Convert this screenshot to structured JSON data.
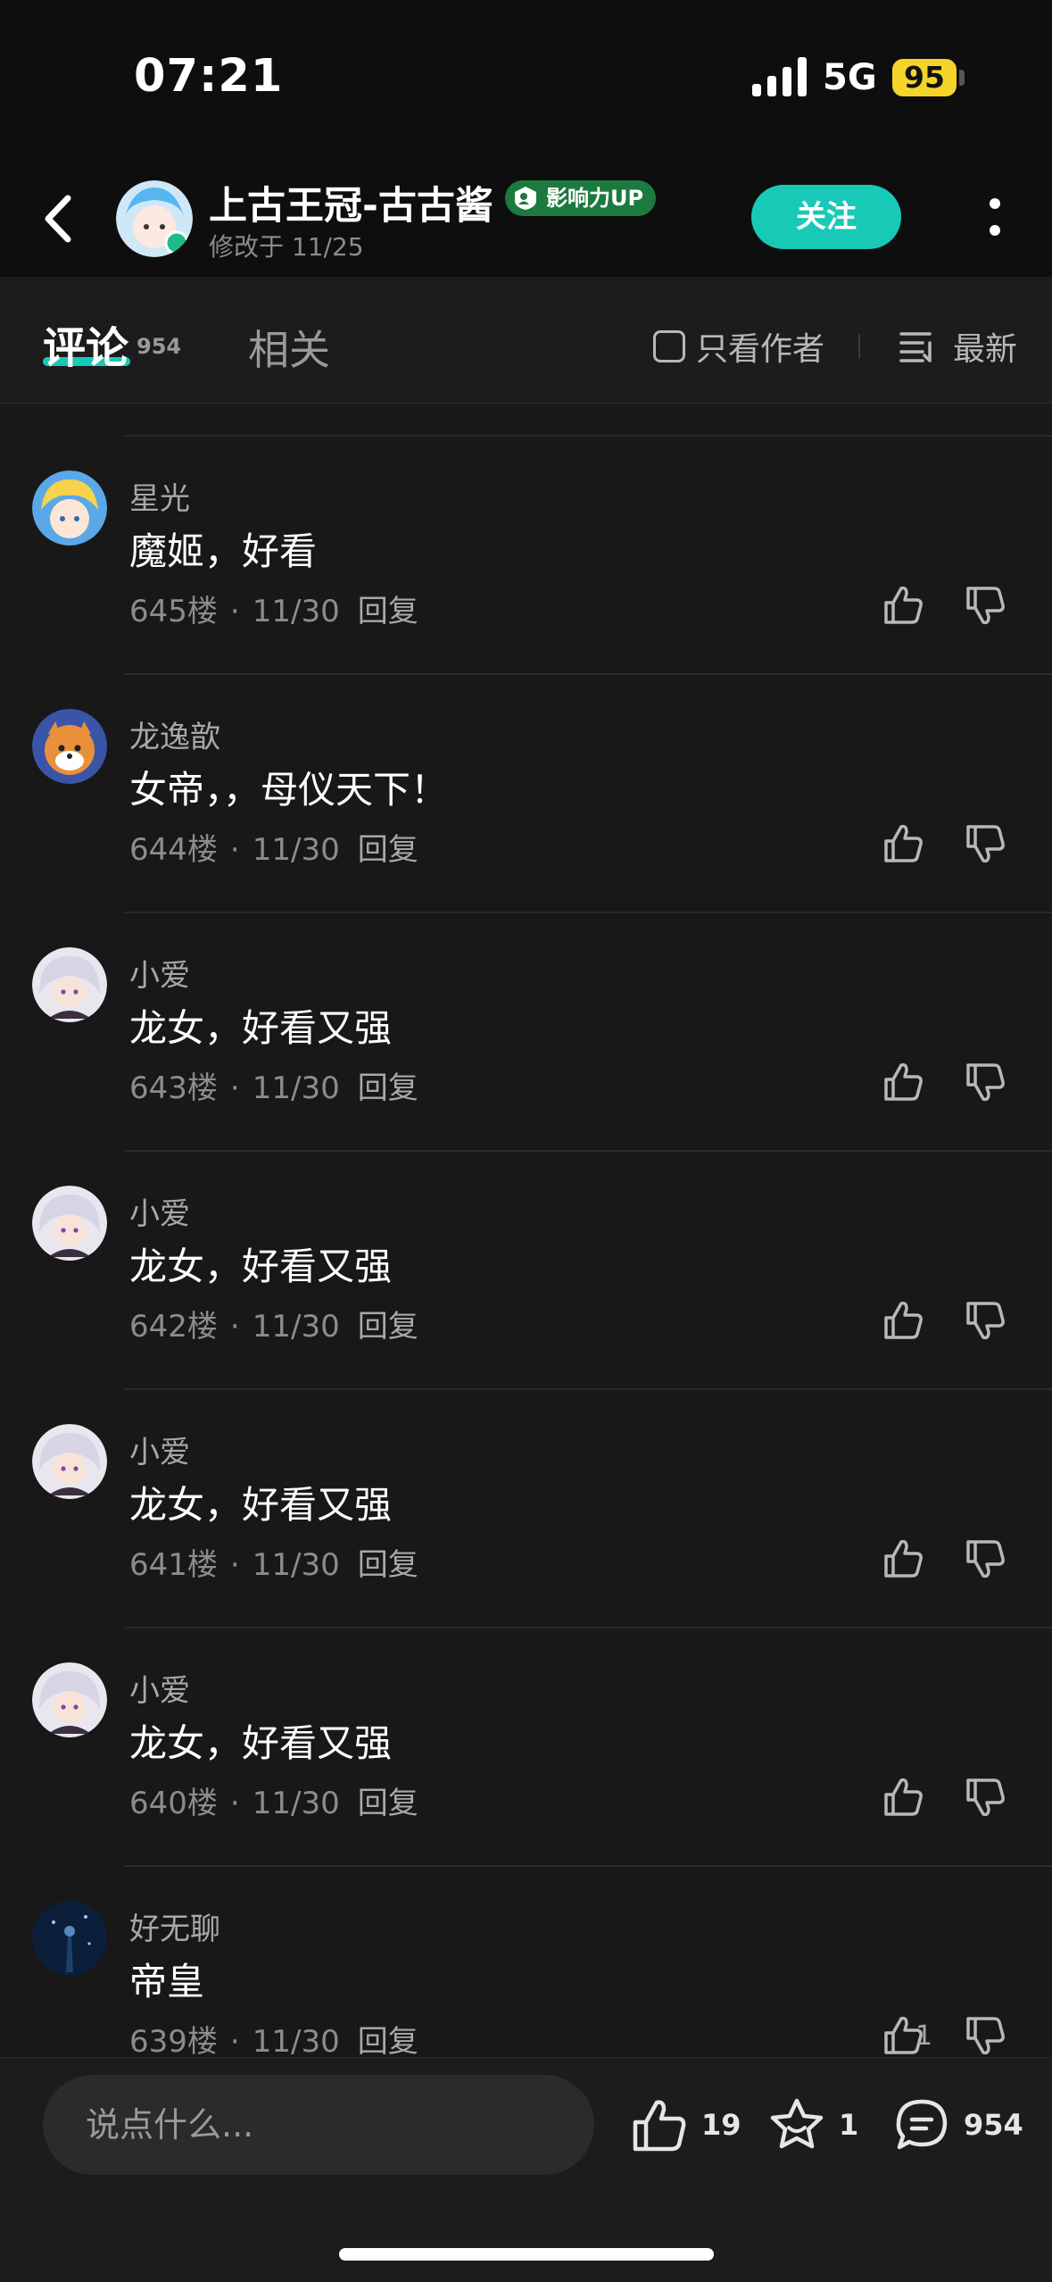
{
  "status_bar": {
    "time": "07:21",
    "network": "5G",
    "battery": "95"
  },
  "header": {
    "up_name": "上古王冠-古古酱",
    "badge": "影响力UP",
    "modified": "修改于 11/25",
    "follow_label": "关注"
  },
  "tabs": {
    "comments_label": "评论",
    "comments_count": "954",
    "related_label": "相关",
    "author_only_label": "只看作者",
    "sort_label": "最新"
  },
  "comments": [
    {
      "name": "星光",
      "text": "魔姬，好看",
      "floor": "645楼",
      "date": "11/30",
      "reply": "回复",
      "likes": ""
    },
    {
      "name": "龙逸歆",
      "text": "女帝，，母仪天下！",
      "floor": "644楼",
      "date": "11/30",
      "reply": "回复",
      "likes": ""
    },
    {
      "name": "小爱",
      "text": "龙女，好看又强",
      "floor": "643楼",
      "date": "11/30",
      "reply": "回复",
      "likes": ""
    },
    {
      "name": "小爱",
      "text": "龙女，好看又强",
      "floor": "642楼",
      "date": "11/30",
      "reply": "回复",
      "likes": ""
    },
    {
      "name": "小爱",
      "text": "龙女，好看又强",
      "floor": "641楼",
      "date": "11/30",
      "reply": "回复",
      "likes": ""
    },
    {
      "name": "小爱",
      "text": "龙女，好看又强",
      "floor": "640楼",
      "date": "11/30",
      "reply": "回复",
      "likes": ""
    },
    {
      "name": "好无聊",
      "text": "帝皇",
      "floor": "639楼",
      "date": "11/30",
      "reply": "回复",
      "likes": "1"
    }
  ],
  "bottom_bar": {
    "input_placeholder": "说点什么...",
    "like_count": "19",
    "favorite_count": "1",
    "comment_count": "954"
  },
  "colors": {
    "accent": "#19c9b8",
    "badge_green": "#1c7a3f",
    "battery": "#f5d42a"
  }
}
